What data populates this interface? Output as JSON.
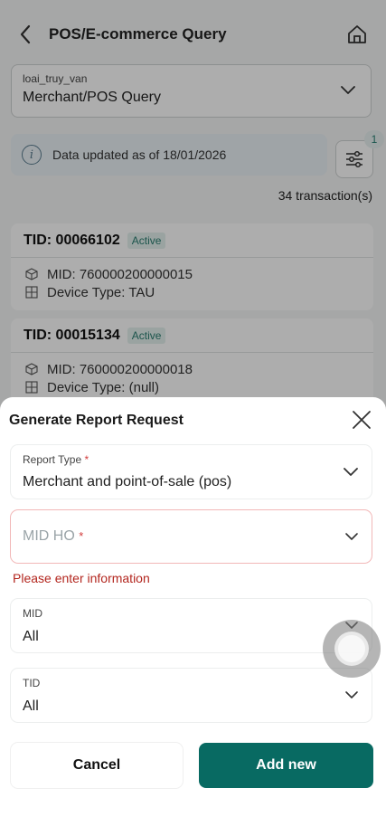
{
  "header": {
    "title": "POS/E-commerce Query",
    "back_icon": "chevron-left-icon",
    "home_icon": "home-icon"
  },
  "query_select": {
    "label": "loai_truy_van",
    "value": "Merchant/POS Query"
  },
  "info_banner": {
    "text": "Data updated as of 18/01/2026",
    "icon": "info-icon"
  },
  "filter": {
    "badge": "1",
    "icon": "sliders-icon"
  },
  "transactions_count": "34 transaction(s)",
  "transactions": [
    {
      "tid": "TID: 00066102",
      "status": "Active",
      "mid": "MID: 760000200000015",
      "device_type": "Device Type: TAU"
    },
    {
      "tid": "TID: 00015134",
      "status": "Active",
      "mid": "MID: 760000200000018",
      "device_type": "Device Type: (null)"
    }
  ],
  "sheet": {
    "title": "Generate Report Request",
    "report_type": {
      "label": "Report Type",
      "required_mark": "*",
      "value": "Merchant and point-of-sale (pos)"
    },
    "mid_ho": {
      "placeholder": "MID HO",
      "required_mark": "*",
      "error": "Please enter information"
    },
    "mid": {
      "label": "MID",
      "value": "All"
    },
    "tid": {
      "label": "TID",
      "value": "All"
    },
    "cancel_label": "Cancel",
    "add_label": "Add new"
  },
  "colors": {
    "primary": "#086a62",
    "error": "#b3261e",
    "badge_bg": "#e3f1ee"
  }
}
